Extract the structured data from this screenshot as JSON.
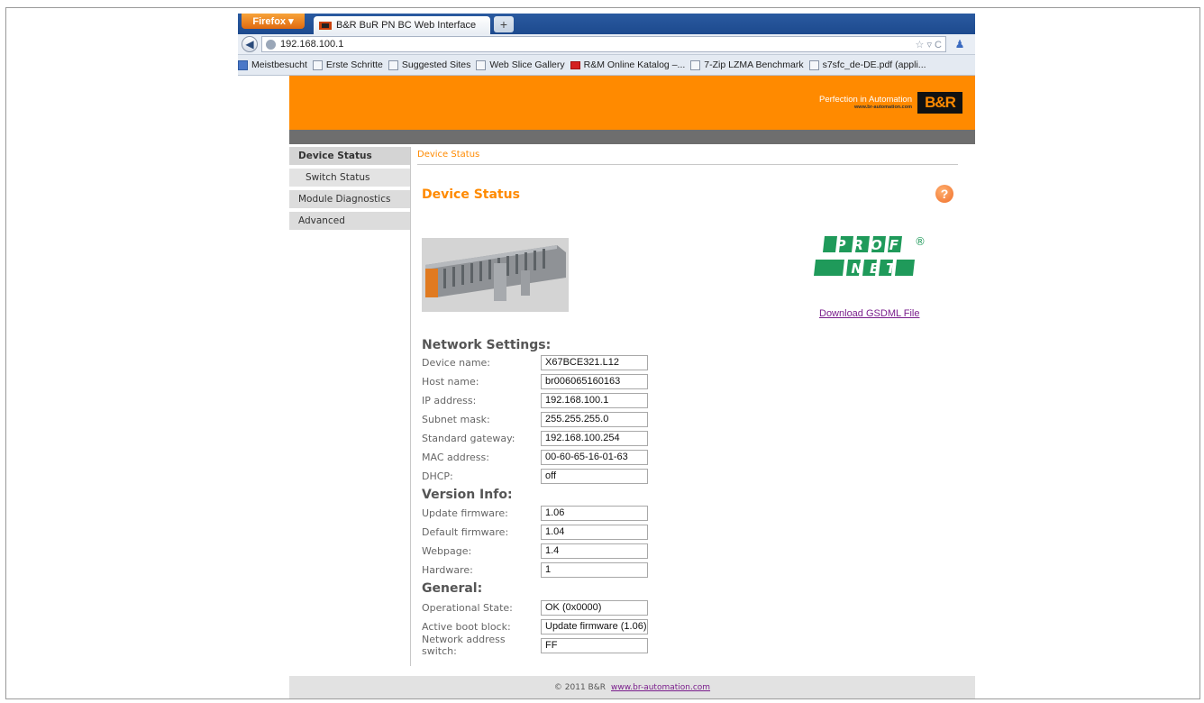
{
  "browser": {
    "menu_button": "Firefox ▾",
    "tab_title": "B&R BuR PN BC Web Interface",
    "new_tab": "+",
    "url": "192.168.100.1",
    "url_controls": "☆ ▿ C",
    "bookmarks": [
      "Meistbesucht",
      "Erste Schritte",
      "Suggested Sites",
      "Web Slice Gallery",
      "R&M Online Katalog –...",
      "7-Zip LZMA Benchmark",
      "s7sfc_de-DE.pdf (appli..."
    ]
  },
  "brand": {
    "tagline": "Perfection in Automation",
    "url": "www.br-automation.com",
    "logo": "B&R"
  },
  "sidebar": {
    "items": [
      "Device Status",
      "Switch Status",
      "Module Diagnostics",
      "Advanced"
    ]
  },
  "main": {
    "breadcrumb": "Device Status",
    "title": "Device Status",
    "help": "?",
    "download_link": "Download GSDML File",
    "profinet": {
      "top": "PROFI",
      "bottom": "NET",
      "mark": "®"
    }
  },
  "network": {
    "heading": "Network Settings:",
    "rows": [
      {
        "label": "Device name:",
        "value": "X67BCE321.L12"
      },
      {
        "label": "Host name:",
        "value": "br006065160163"
      },
      {
        "label": "IP address:",
        "value": "192.168.100.1"
      },
      {
        "label": "Subnet mask:",
        "value": "255.255.255.0"
      },
      {
        "label": "Standard gateway:",
        "value": "192.168.100.254"
      },
      {
        "label": "MAC address:",
        "value": "00-60-65-16-01-63"
      },
      {
        "label": "DHCP:",
        "value": "off"
      }
    ]
  },
  "version": {
    "heading": "Version Info:",
    "rows": [
      {
        "label": "Update firmware:",
        "value": "1.06"
      },
      {
        "label": "Default firmware:",
        "value": "1.04"
      },
      {
        "label": "Webpage:",
        "value": "1.4"
      },
      {
        "label": "Hardware:",
        "value": "1"
      }
    ]
  },
  "general": {
    "heading": "General:",
    "rows": [
      {
        "label": "Operational State:",
        "value": "OK (0x0000)"
      },
      {
        "label": "Active boot block:",
        "value": "Update firmware (1.06)"
      },
      {
        "label": "Network address switch:",
        "value": "FF"
      }
    ]
  },
  "footer": {
    "copyright": "© 2011 B&R",
    "link": "www.br-automation.com"
  },
  "colors": {
    "accent": "#ff8a00",
    "band": "#6e6e6e"
  }
}
